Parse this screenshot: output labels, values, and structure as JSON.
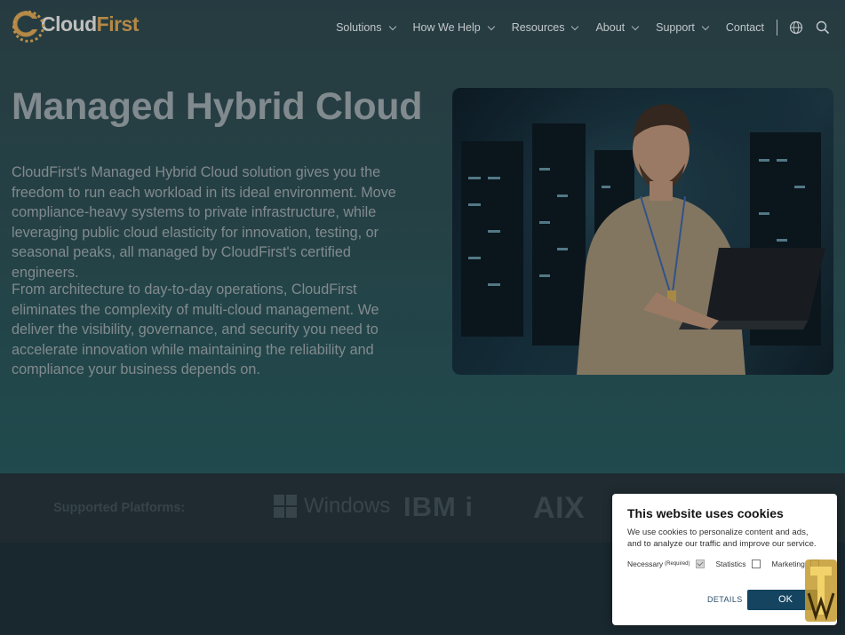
{
  "header": {
    "logo": {
      "text_main": "Cloud",
      "text_accent": "First"
    },
    "nav": [
      {
        "label": "Solutions",
        "dropdown": true
      },
      {
        "label": "How We Help",
        "dropdown": true
      },
      {
        "label": "Resources",
        "dropdown": true
      },
      {
        "label": "About",
        "dropdown": true
      },
      {
        "label": "Support",
        "dropdown": true
      },
      {
        "label": "Contact",
        "dropdown": false
      }
    ],
    "icons": [
      "globe-icon",
      "search-icon"
    ]
  },
  "hero": {
    "title": "Managed Hybrid Cloud",
    "paragraph1": "CloudFirst's Managed Hybrid Cloud solution gives you the freedom to run each workload in its ideal environment. Move compliance-heavy systems to private infrastructure, while leveraging public cloud elasticity for innovation, testing, or seasonal peaks, all managed by CloudFirst's certified engineers.",
    "paragraph2": "From architecture to day-to-day operations, CloudFirst eliminates the complexity of multi-cloud management. We deliver the visibility, governance, and security you need to accelerate innovation while maintaining the reliability and compliance your business depends on."
  },
  "platforms": {
    "label": "Supported Platforms:",
    "items": [
      "Windows",
      "IBM i",
      "AIX"
    ]
  },
  "cookie": {
    "title": "This website uses cookies",
    "text": "We use cookies to personalize content and ads, and to analyze our traffic and improve our service.",
    "options": [
      {
        "label": "Necessary",
        "note": "(Required)",
        "checked": true
      },
      {
        "label": "Statistics",
        "checked": false
      },
      {
        "label": "Marketing",
        "checked": false
      }
    ],
    "details_label": "DETAILS",
    "ok_label": "OK"
  },
  "colors": {
    "accent": "#d8a04f",
    "ok_button": "#14445f",
    "hero_text": "#9aa3a6"
  }
}
